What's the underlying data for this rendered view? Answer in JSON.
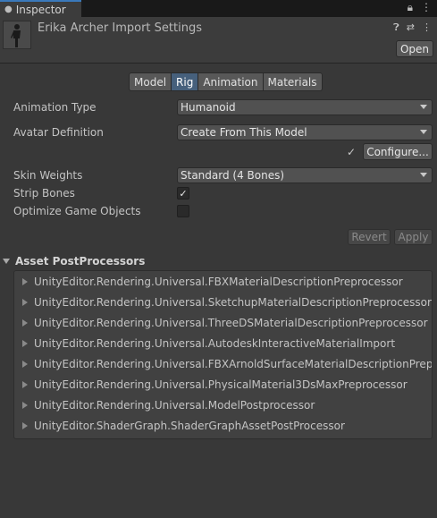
{
  "window": {
    "tab_label": "Inspector",
    "tab_icon": "info-icon",
    "tab_icons": [
      "lock-icon",
      "kebab-menu-icon"
    ]
  },
  "header": {
    "title": "Erika Archer Import Settings",
    "icons": [
      "help-icon",
      "preset-icon",
      "kebab-menu-icon"
    ],
    "open_label": "Open"
  },
  "tabs": [
    {
      "label": "Model",
      "active": false
    },
    {
      "label": "Rig",
      "active": true
    },
    {
      "label": "Animation",
      "active": false
    },
    {
      "label": "Materials",
      "active": false
    }
  ],
  "rig": {
    "animation_type": {
      "label": "Animation Type",
      "value": "Humanoid"
    },
    "avatar_definition": {
      "label": "Avatar Definition",
      "value": "Create From This Model"
    },
    "configure_label": "Configure...",
    "configure_check": "✓",
    "skin_weights": {
      "label": "Skin Weights",
      "value": "Standard (4 Bones)"
    },
    "strip_bones": {
      "label": "Strip Bones",
      "checked": true
    },
    "optimize_game_objects": {
      "label": "Optimize Game Objects",
      "checked": false
    },
    "revert_label": "Revert",
    "apply_label": "Apply"
  },
  "postprocessors": {
    "title": "Asset PostProcessors",
    "items": [
      "UnityEditor.Rendering.Universal.FBXMaterialDescriptionPreprocessor",
      "UnityEditor.Rendering.Universal.SketchupMaterialDescriptionPreprocessor",
      "UnityEditor.Rendering.Universal.ThreeDSMaterialDescriptionPreprocessor",
      "UnityEditor.Rendering.Universal.AutodeskInteractiveMaterialImport",
      "UnityEditor.Rendering.Universal.FBXArnoldSurfaceMaterialDescriptionPreprocessor",
      "UnityEditor.Rendering.Universal.PhysicalMaterial3DsMaxPreprocessor",
      "UnityEditor.Rendering.Universal.ModelPostprocessor",
      "UnityEditor.ShaderGraph.ShaderGraphAssetPostProcessor"
    ]
  },
  "colors": {
    "background": "#383838",
    "active_tab": "#46607c",
    "focus_accent": "#3a79bb"
  }
}
